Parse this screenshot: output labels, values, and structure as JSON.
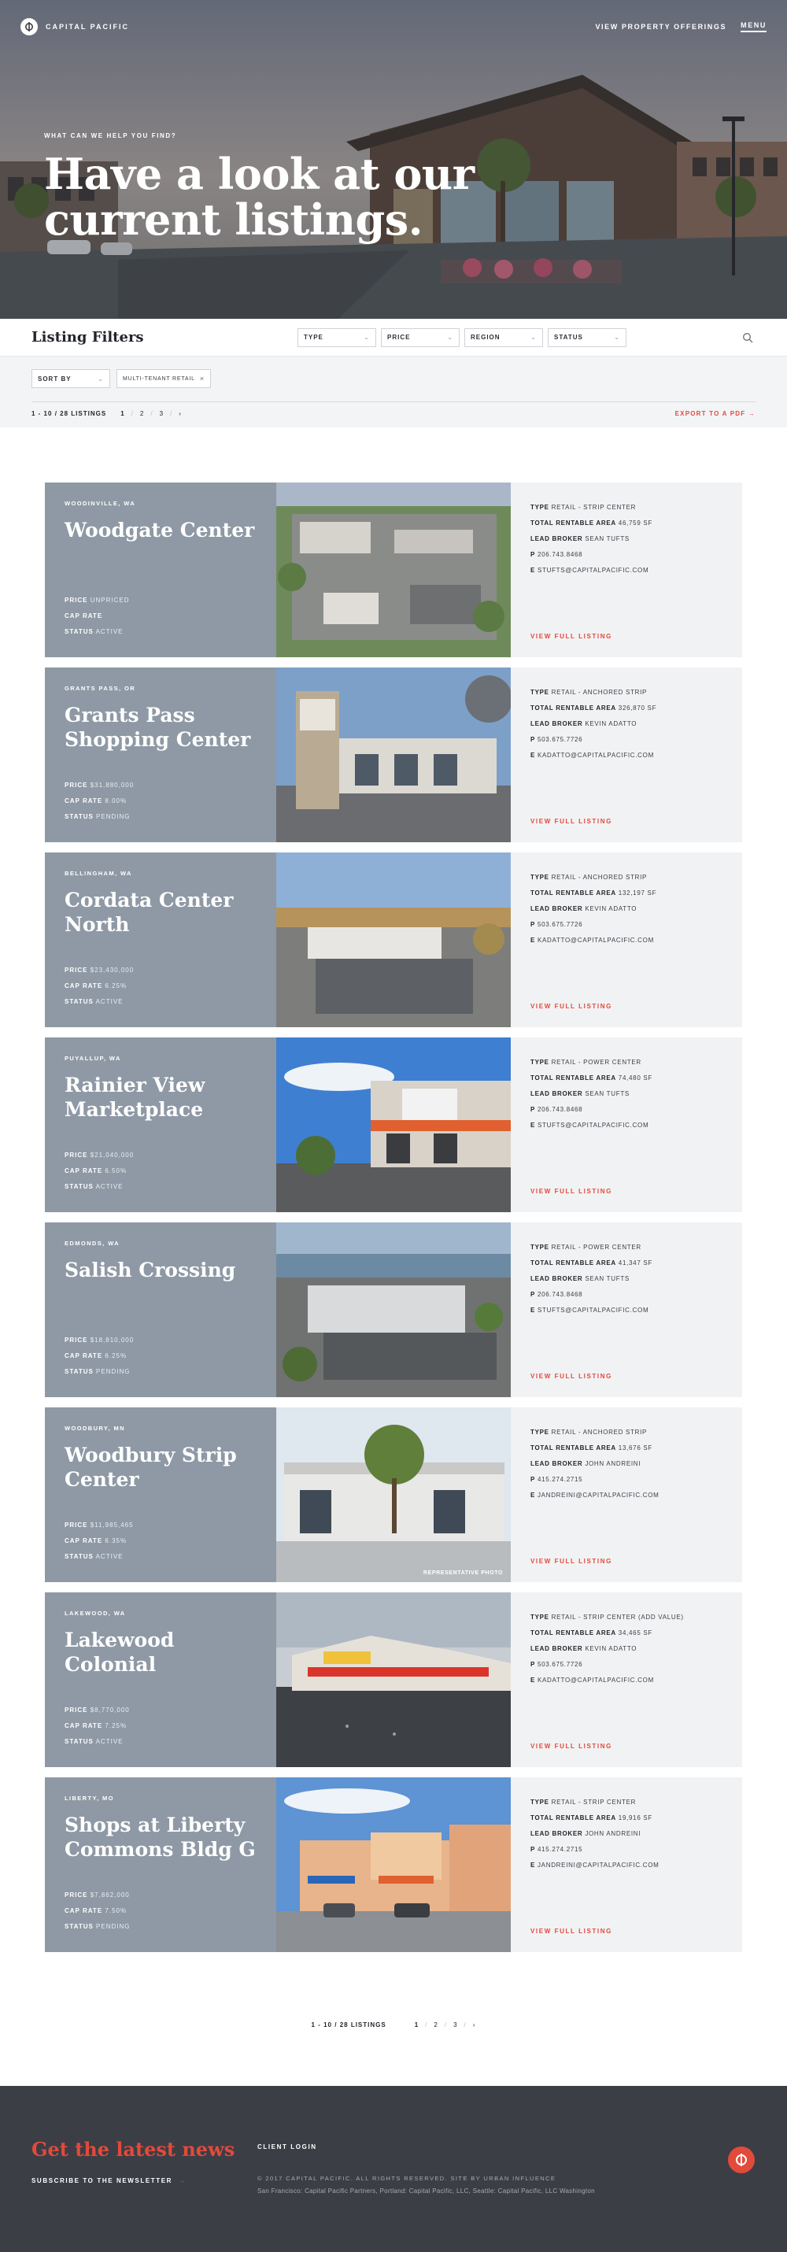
{
  "header": {
    "logo_text": "CAPITAL PACIFIC",
    "nav": {
      "offerings": "VIEW PROPERTY OFFERINGS",
      "menu": "MENU"
    },
    "kicker": "WHAT CAN WE HELP YOU FIND?",
    "title_line1": "Have a look at our",
    "title_line2": "current listings."
  },
  "filters": {
    "heading": "Listing Filters",
    "selects": [
      "TYPE",
      "PRICE",
      "REGION",
      "STATUS"
    ],
    "sort_label": "SORT BY",
    "active_chip": "MULTI-TENANT RETAIL"
  },
  "pagination": {
    "count_text": "1 - 10",
    "separator": "/",
    "total_text": "28 LISTINGS",
    "pages": [
      "1",
      "2",
      "3"
    ],
    "next": "›",
    "export": "EXPORT TO A PDF"
  },
  "labels": {
    "price": "PRICE",
    "cap_rate": "CAP RATE",
    "status": "STATUS",
    "type": "TYPE",
    "total_area": "TOTAL RENTABLE AREA",
    "lead_broker": "LEAD BROKER",
    "phone": "P",
    "email": "E",
    "view_full": "VIEW FULL LISTING",
    "rep_photo": "REPRESENTATIVE PHOTO"
  },
  "listings": [
    {
      "location": "WOODINVILLE, WA",
      "name": "Woodgate Center",
      "price": "UNPRICED",
      "cap_rate": "",
      "status": "ACTIVE",
      "type": "RETAIL - STRIP CENTER",
      "area": "46,759 SF",
      "broker": "SEAN TUFTS",
      "phone": "206.743.8468",
      "email": "STUFTS@CAPITALPACIFIC.COM"
    },
    {
      "location": "GRANTS PASS, OR",
      "name": "Grants Pass Shopping Center",
      "price": "$31,880,000",
      "cap_rate": "8.00%",
      "status": "PENDING",
      "type": "RETAIL - ANCHORED STRIP",
      "area": "326,870 SF",
      "broker": "KEVIN ADATTO",
      "phone": "503.675.7726",
      "email": "KADATTO@CAPITALPACIFIC.COM"
    },
    {
      "location": "BELLINGHAM, WA",
      "name": "Cordata Center North",
      "price": "$23,430,000",
      "cap_rate": "6.25%",
      "status": "ACTIVE",
      "type": "RETAIL - ANCHORED STRIP",
      "area": "132,197 SF",
      "broker": "KEVIN ADATTO",
      "phone": "503.675.7726",
      "email": "KADATTO@CAPITALPACIFIC.COM"
    },
    {
      "location": "PUYALLUP, WA",
      "name": "Rainier View Marketplace",
      "price": "$21,040,000",
      "cap_rate": "6.50%",
      "status": "ACTIVE",
      "type": "RETAIL - POWER CENTER",
      "area": "74,480 SF",
      "broker": "SEAN TUFTS",
      "phone": "206.743.8468",
      "email": "STUFTS@CAPITALPACIFIC.COM"
    },
    {
      "location": "EDMONDS, WA",
      "name": "Salish Crossing",
      "price": "$18,810,000",
      "cap_rate": "6.25%",
      "status": "PENDING",
      "type": "RETAIL - POWER CENTER",
      "area": "41,347 SF",
      "broker": "SEAN TUFTS",
      "phone": "206.743.8468",
      "email": "STUFTS@CAPITALPACIFIC.COM"
    },
    {
      "location": "WOODBURY, MN",
      "name": "Woodbury Strip Center",
      "price": "$11,985,465",
      "cap_rate": "6.35%",
      "status": "ACTIVE",
      "type": "RETAIL - ANCHORED STRIP",
      "area": "13,676 SF",
      "broker": "JOHN ANDREINI",
      "phone": "415.274.2715",
      "email": "JANDREINI@CAPITALPACIFIC.COM"
    },
    {
      "location": "LAKEWOOD, WA",
      "name": "Lakewood Colonial",
      "price": "$8,770,000",
      "cap_rate": "7.25%",
      "status": "ACTIVE",
      "type": "RETAIL - STRIP CENTER (ADD VALUE)",
      "area": "34,465 SF",
      "broker": "KEVIN ADATTO",
      "phone": "503.675.7726",
      "email": "KADATTO@CAPITALPACIFIC.COM"
    },
    {
      "location": "LIBERTY, MO",
      "name": "Shops at Liberty Commons Bldg G",
      "price": "$7,862,000",
      "cap_rate": "7.50%",
      "status": "PENDING",
      "type": "RETAIL - STRIP CENTER",
      "area": "19,916 SF",
      "broker": "JOHN ANDREINI",
      "phone": "415.274.2715",
      "email": "JANDREINI@CAPITALPACIFIC.COM"
    }
  ],
  "footer": {
    "newsletter_title": "Get the latest news",
    "subscribe": "SUBSCRIBE TO THE NEWSLETTER",
    "subscribe_arrow": "→",
    "client_login": "CLIENT LOGIN",
    "copyright": "© 2017 CAPITAL PACIFIC. ALL RIGHTS RESERVED. SITE BY URBAN INFLUENCE",
    "cities": "San Francisco: Capital Pacific Partners, Portland: Capital Pacific, LLC, Seattle: Capital Pacific, LLC Washington"
  },
  "colors": {
    "accent": "#e24a3b",
    "card_left": "#8e99a5",
    "card_right": "#f1f2f4",
    "footer": "#3b3e45"
  }
}
